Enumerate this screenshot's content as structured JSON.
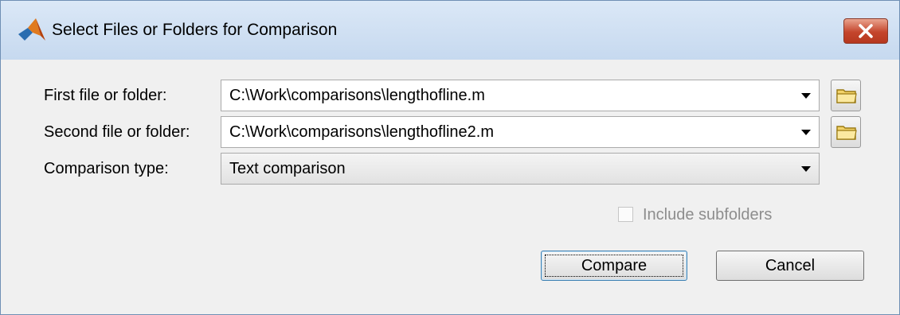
{
  "window": {
    "title": "Select Files or Folders for Comparison"
  },
  "form": {
    "first_label": "First file or folder:",
    "first_value": "C:\\Work\\comparisons\\lengthofline.m",
    "second_label": "Second file or folder:",
    "second_value": "C:\\Work\\comparisons\\lengthofline2.m",
    "type_label": "Comparison type:",
    "type_value": "Text comparison",
    "include_subfolders_label": "Include subfolders",
    "include_subfolders_checked": false,
    "include_subfolders_enabled": false
  },
  "buttons": {
    "compare": "Compare",
    "cancel": "Cancel"
  },
  "icons": {
    "app": "matlab-logo-icon",
    "close": "close-icon",
    "browse": "folder-icon",
    "dropdown": "chevron-down-icon"
  },
  "colors": {
    "titlebar": "#c6d9ef",
    "close_button": "#c4452c",
    "background": "#f0f0f0",
    "disabled_text": "#8d8d8d",
    "default_button_border": "#3c7fb1"
  }
}
